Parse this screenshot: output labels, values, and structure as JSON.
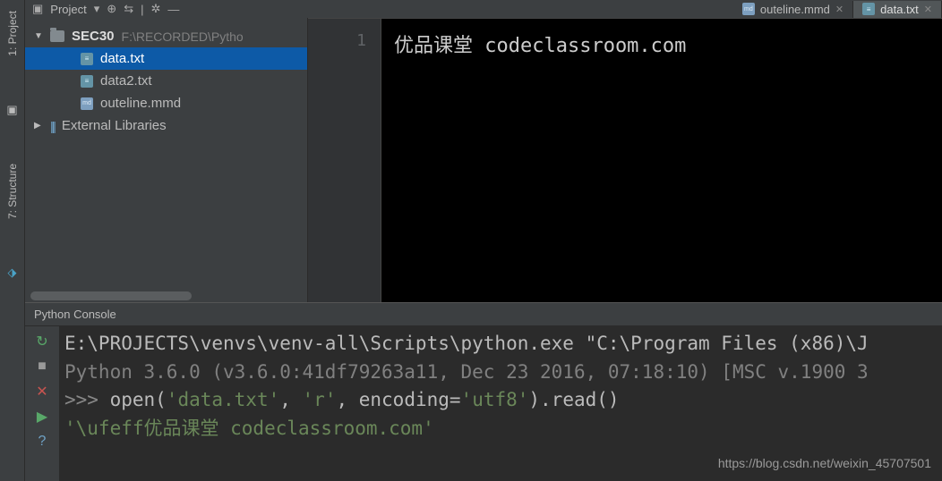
{
  "leftGutter": {
    "project": "1: Project",
    "structure": "7: Structure"
  },
  "projectHeader": {
    "label": "Project"
  },
  "editorTabs": [
    {
      "name": "outeline.mmd",
      "type": "mmd",
      "active": false
    },
    {
      "name": "data.txt",
      "type": "txt",
      "active": true
    }
  ],
  "tree": {
    "root": {
      "name": "SEC30",
      "path": "F:\\RECORDED\\Pytho"
    },
    "files": [
      {
        "name": "data.txt",
        "type": "txt",
        "selected": true
      },
      {
        "name": "data2.txt",
        "type": "txt",
        "selected": false
      },
      {
        "name": "outeline.mmd",
        "type": "mmd",
        "selected": false
      }
    ],
    "extlib": "External Libraries"
  },
  "editor": {
    "lineNumbers": [
      "1"
    ],
    "line0": "优品课堂 codeclassroom.com"
  },
  "console": {
    "tab": "Python Console",
    "line0": "E:\\PROJECTS\\venvs\\venv-all\\Scripts\\python.exe \"C:\\Program Files (x86)\\J",
    "line1": "Python 3.6.0 (v3.6.0:41df79263a11, Dec 23 2016, 07:18:10) [MSC v.1900 3",
    "prompt": ">>>",
    "code_open": " open(",
    "code_arg1": "'data.txt'",
    "code_c1": ", ",
    "code_arg2": "'r'",
    "code_c2": ", encoding=",
    "code_arg3": "'utf8'",
    "code_tail": ").read()",
    "result": "'\\ufeff优品课堂 codeclassroom.com'"
  },
  "watermark": "https://blog.csdn.net/weixin_45707501"
}
